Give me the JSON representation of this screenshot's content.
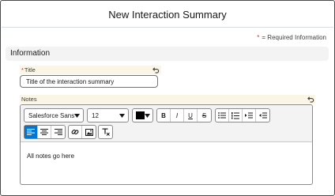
{
  "header": {
    "title": "New Interaction Summary"
  },
  "required_note": {
    "star": "*",
    "text": "= Required Information"
  },
  "section": {
    "label": "Information"
  },
  "title_field": {
    "required_star": "*",
    "label": "Title",
    "value": "Title of the interaction summary",
    "undo_icon": "undo-icon"
  },
  "notes_field": {
    "label": "Notes",
    "undo_icon": "undo-icon",
    "toolbar": {
      "font_family": "Salesforce Sans",
      "font_size": "12",
      "text_color": "#000000",
      "bold": "B",
      "italic": "I",
      "underline": "U",
      "strikethrough": "S",
      "align_left_active": true
    },
    "content": "All notes go here"
  },
  "colors": {
    "accent": "#0176d3",
    "label_bg": "#faf5e4",
    "section_bg": "#f3f3f3",
    "required": "#c23934"
  }
}
